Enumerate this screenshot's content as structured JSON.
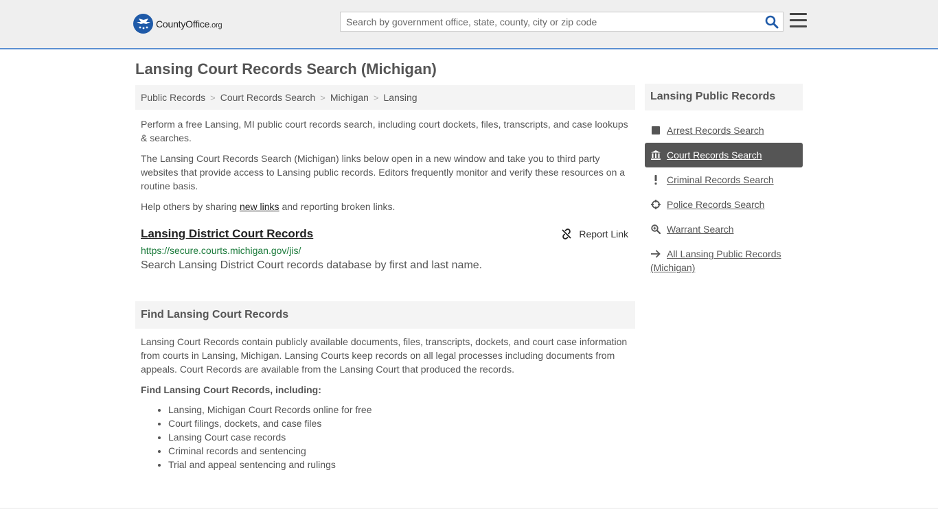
{
  "header": {
    "logo_main": "CountyOffice",
    "logo_sub": ".org",
    "search_placeholder": "Search by government office, state, county, city or zip code"
  },
  "page": {
    "title": "Lansing Court Records Search (Michigan)"
  },
  "breadcrumb": [
    "Public Records",
    "Court Records Search",
    "Michigan",
    "Lansing"
  ],
  "intro": {
    "p1": "Perform a free Lansing, MI public court records search, including court dockets, files, transcripts, and case lookups & searches.",
    "p2": "The Lansing Court Records Search (Michigan) links below open in a new window and take you to third party websites that provide access to Lansing public records. Editors frequently monitor and verify these resources on a routine basis.",
    "p3_before": "Help others by sharing ",
    "p3_link": "new links",
    "p3_after": " and reporting broken links."
  },
  "record": {
    "title": "Lansing District Court Records",
    "url": "https://secure.courts.michigan.gov/jis/",
    "description": "Search Lansing District Court records database by first and last name.",
    "report_label": "Report Link"
  },
  "find": {
    "heading": "Find Lansing Court Records",
    "body": "Lansing Court Records contain publicly available documents, files, transcripts, dockets, and court case information from courts in Lansing, Michigan. Lansing Courts keep records on all legal processes including documents from appeals. Court Records are available from the Lansing Court that produced the records.",
    "subheading": "Find Lansing Court Records, including:",
    "items": [
      "Lansing, Michigan Court Records online for free",
      "Court filings, dockets, and case files",
      "Lansing Court case records",
      "Criminal records and sentencing",
      "Trial and appeal sentencing and rulings"
    ]
  },
  "sidebar": {
    "heading": "Lansing Public Records",
    "items": [
      {
        "label": "Arrest Records Search",
        "icon": "square-icon"
      },
      {
        "label": "Court Records Search",
        "icon": "courthouse-icon"
      },
      {
        "label": "Criminal Records Search",
        "icon": "exclamation-icon"
      },
      {
        "label": "Police Records Search",
        "icon": "crosshair-icon"
      },
      {
        "label": "Warrant Search",
        "icon": "magnifier-icon"
      },
      {
        "label": "All Lansing Public Records (Michigan)",
        "icon": "arrow-right-icon"
      }
    ]
  },
  "colors": {
    "accent_blue": "#1f5aa8",
    "header_border": "#5b8fd1",
    "url_green": "#1a7a3a",
    "active_bg": "#555555"
  }
}
